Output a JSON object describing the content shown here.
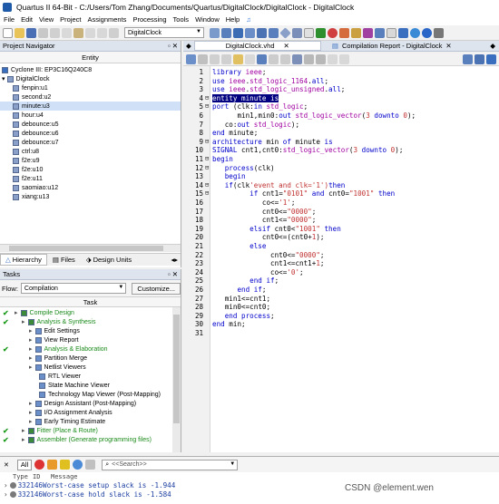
{
  "window": {
    "title": "Quartus II 64-Bit - C:/Users/Tom Zhang/Documents/Quartus/DigitalClock/DigitalClock - DigitalClock"
  },
  "menu": [
    "File",
    "Edit",
    "View",
    "Project",
    "Assignments",
    "Processing",
    "Tools",
    "Window",
    "Help"
  ],
  "toolbar": {
    "project_combo": "DigitalClock"
  },
  "navigator": {
    "title": "Project Navigator",
    "column": "Entity",
    "device": "Cyclone III: EP3C16Q240C8",
    "root": "DigitalClock",
    "items": [
      "fenpin:u1",
      "second:u2",
      "minute:u3",
      "hour:u4",
      "debounce:u5",
      "debounce:u6",
      "debounce:u7",
      "ctrl:u8",
      "f2e:u9",
      "f2e:u10",
      "f2e:u11",
      "saomiao:u12",
      "xiang:u13"
    ],
    "tabs": [
      "Hierarchy",
      "Files",
      "Design Units"
    ]
  },
  "tasks": {
    "title": "Tasks",
    "flow_label": "Flow:",
    "flow_value": "Compilation",
    "customize": "Customize...",
    "column": "Task",
    "rows": [
      {
        "label": "Compile Design",
        "level": 0,
        "check": true,
        "color": "#1a8a1a"
      },
      {
        "label": "Analysis & Synthesis",
        "level": 1,
        "check": true,
        "color": "#1a8a1a"
      },
      {
        "label": "Edit Settings",
        "level": 2,
        "check": false,
        "color": "#000"
      },
      {
        "label": "View Report",
        "level": 2,
        "check": false,
        "color": "#000"
      },
      {
        "label": "Analysis & Elaboration",
        "level": 2,
        "check": true,
        "color": "#1a8a1a"
      },
      {
        "label": "Partition Merge",
        "level": 2,
        "check": false,
        "color": "#000"
      },
      {
        "label": "Netlist Viewers",
        "level": 2,
        "check": false,
        "color": "#000"
      },
      {
        "label": "RTL Viewer",
        "level": 3,
        "check": false,
        "color": "#000"
      },
      {
        "label": "State Machine Viewer",
        "level": 3,
        "check": false,
        "color": "#000"
      },
      {
        "label": "Technology Map Viewer (Post-Mapping)",
        "level": 3,
        "check": false,
        "color": "#000"
      },
      {
        "label": "Design Assistant (Post-Mapping)",
        "level": 2,
        "check": false,
        "color": "#000"
      },
      {
        "label": "I/O Assignment Analysis",
        "level": 2,
        "check": false,
        "color": "#000"
      },
      {
        "label": "Early Timing Estimate",
        "level": 2,
        "check": false,
        "color": "#000"
      },
      {
        "label": "Fitter (Place & Route)",
        "level": 1,
        "check": true,
        "color": "#1a8a1a"
      },
      {
        "label": "Assembler (Generate programming files)",
        "level": 1,
        "check": true,
        "color": "#1a8a1a"
      }
    ]
  },
  "editor": {
    "tabs": [
      "DigitalClock.vhd",
      "Compilation Report - DigitalClock"
    ],
    "lines": [
      "library ieee;",
      "use ieee.std_logic_1164.all;",
      "use ieee.std_logic_unsigned.all;",
      "entity minute is",
      "port (clk:in std_logic;",
      "      min1,min0:out std_logic_vector(3 downto 0);",
      "   co:out std_logic);",
      "end minute;",
      "architecture min of minute is",
      "SIGNAL cnt1,cnt0:std_logic_vector(3 downto 0);",
      "begin",
      "   process(clk)",
      "   begin",
      "   if(clk'event and clk='1')then",
      "         if cnt1=\"0101\" and cnt0=\"1001\" then",
      "            co<='1';",
      "            cnt0<=\"0000\";",
      "            cnt1<=\"0000\";",
      "         elsif cnt0<\"1001\" then",
      "            cnt0<=(cnt0+1);",
      "         else",
      "              cnt0<=\"0000\";",
      "              cnt1<=cnt1+1;",
      "              co<='0';",
      "         end if;",
      "      end if;",
      "   min1<=cnt1;",
      "   min0<=cnt0;",
      "   end process;",
      "end min;",
      ""
    ],
    "line_numbers": [
      "1",
      "2",
      "3",
      "4",
      "5",
      "6",
      "7",
      "8",
      "9",
      "10",
      "11",
      "12",
      "13",
      "14",
      "15",
      "16",
      "17",
      "18",
      "19",
      "20",
      "21",
      "22",
      "23",
      "24",
      "25",
      "26",
      "27",
      "28",
      "29",
      "30",
      "31"
    ]
  },
  "messages": {
    "filter_all": "All",
    "search_placeholder": "<<Search>>",
    "columns": [
      "Type",
      "ID",
      "Message"
    ],
    "rows": [
      {
        "id": "332146",
        "text": "Worst-case setup slack is -1.944"
      },
      {
        "id": "332146",
        "text": "Worst-case hold slack is -1.584"
      }
    ]
  },
  "watermark": "CSDN @element.wen"
}
